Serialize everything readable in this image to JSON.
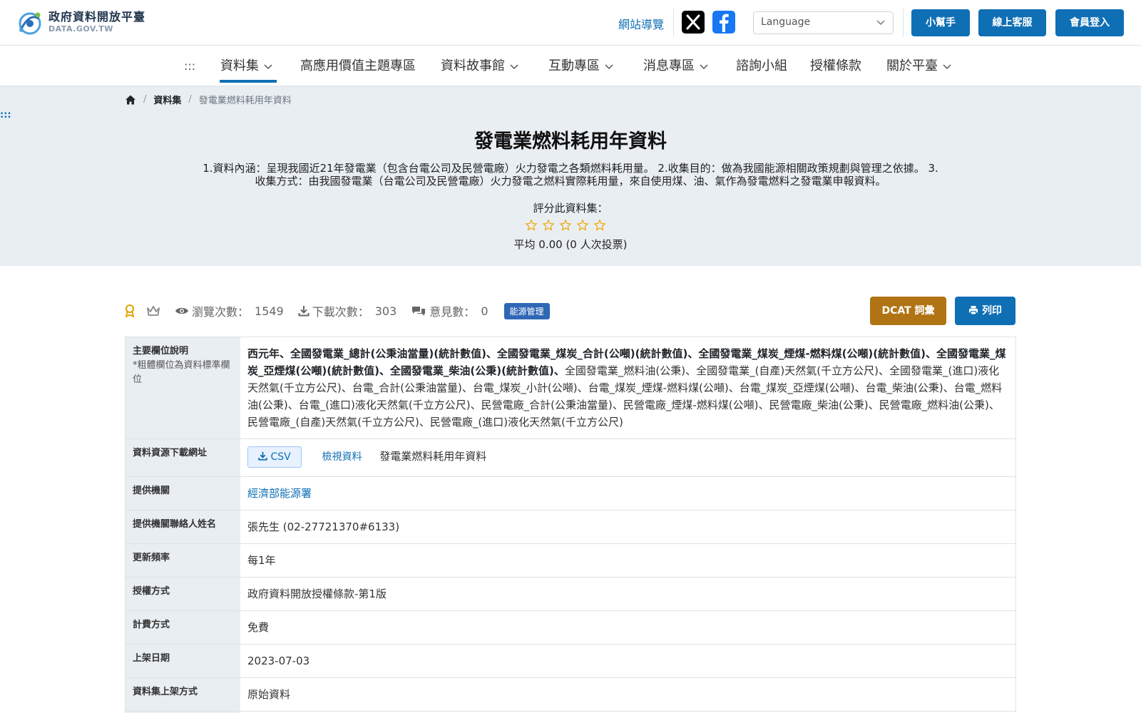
{
  "header": {
    "logo_zh": "政府資料開放平臺",
    "logo_en": "DATA.GOV.TW",
    "sitemap": "網站導覽",
    "language_placeholder": "Language",
    "btn_helper": "小幫手",
    "btn_service": "線上客服",
    "btn_login": "會員登入"
  },
  "nav": {
    "accesskey": ":::",
    "items": [
      {
        "label": "資料集"
      },
      {
        "label": "高應用價值主題專區"
      },
      {
        "label": "資料故事館"
      },
      {
        "label": "互動專區"
      },
      {
        "label": "消息專區"
      },
      {
        "label": "諮詢小組"
      },
      {
        "label": "授權條款"
      },
      {
        "label": "關於平臺"
      }
    ]
  },
  "breadcrumb": {
    "level1": "資料集",
    "current": "發電業燃料耗用年資料"
  },
  "hero": {
    "accesskey": ":::",
    "title": "發電業燃料耗用年資料",
    "description": "1.資料內涵：呈現我國近21年發電業（包含台電公司及民營電廠）火力發電之各類燃料耗用量。 2.收集目的：做為我國能源相關政策規劃與管理之依據。 3.收集方式：由我國發電業（台電公司及民營電廠）火力發電之燃料實際耗用量，來自使用煤、油、氣作為發電燃料之發電業申報資料。",
    "rate_label": "評分此資料集：",
    "rating": 0,
    "rating_max": 5,
    "rate_avg": "平均 0.00 (0 人次投票)"
  },
  "stats": {
    "views_label": "瀏覽次數：",
    "views": "1549",
    "downloads_label": "下載次數：",
    "downloads": "303",
    "comments_label": "意見數：",
    "comments": "0",
    "tag": "能源管理",
    "btn_dcat": "DCAT 詞彙",
    "btn_print": "列印"
  },
  "table": {
    "fields_label": "主要欄位說明",
    "fields_note": "*粗體欄位為資料標準欄位",
    "fields_bold": "西元年、全國發電業_總計(公秉油當量)(統計數值)、全國發電業_煤炭_合計(公噸)(統計數值)、全國發電業_煤炭_煙煤-燃料煤(公噸)(統計數值)、全國發電業_煤炭_亞煙煤(公噸)(統計數值)、全國發電業_柴油(公秉)(統計數值)、",
    "fields_normal": "全國發電業_燃料油(公秉)、全國發電業_(自產)天然氣(千立方公尺)、全國發電業_(進口)液化天然氣(千立方公尺)、台電_合計(公秉油當量)、台電_煤炭_小計(公噸)、台電_煤炭_煙煤-燃料煤(公噸)、台電_煤炭_亞煙煤(公噸)、台電_柴油(公秉)、台電_燃料油(公秉)、台電_(進口)液化天然氣(千立方公尺)、民營電廠_合計(公秉油當量)、民營電廠_煙煤-燃料煤(公噸)、民營電廠_柴油(公秉)、民營電廠_燃料油(公秉)、民營電廠_(自產)天然氣(千立方公尺)、民營電廠_(進口)液化天然氣(千立方公尺)",
    "resource_label": "資料資源下載網址",
    "csv_label": "CSV",
    "view_label": "檢視資料",
    "resource_name": "發電業燃料耗用年資料",
    "provider_label": "提供機關",
    "provider": "經濟部能源署",
    "contact_label": "提供機關聯絡人姓名",
    "contact": "張先生 (02-27721370#6133)",
    "freq_label": "更新頻率",
    "freq": "每1年",
    "license_label": "授權方式",
    "license": "政府資料開放授權條款-第1版",
    "fee_label": "計費方式",
    "fee": "免費",
    "date_label": "上架日期",
    "date": "2023-07-03",
    "method_label": "資料集上架方式",
    "method": "原始資料"
  },
  "colors": {
    "primary": "#0f6fb5",
    "dcat": "#b07414",
    "hero_bg": "#e9eef3",
    "star": "#f0a500"
  }
}
